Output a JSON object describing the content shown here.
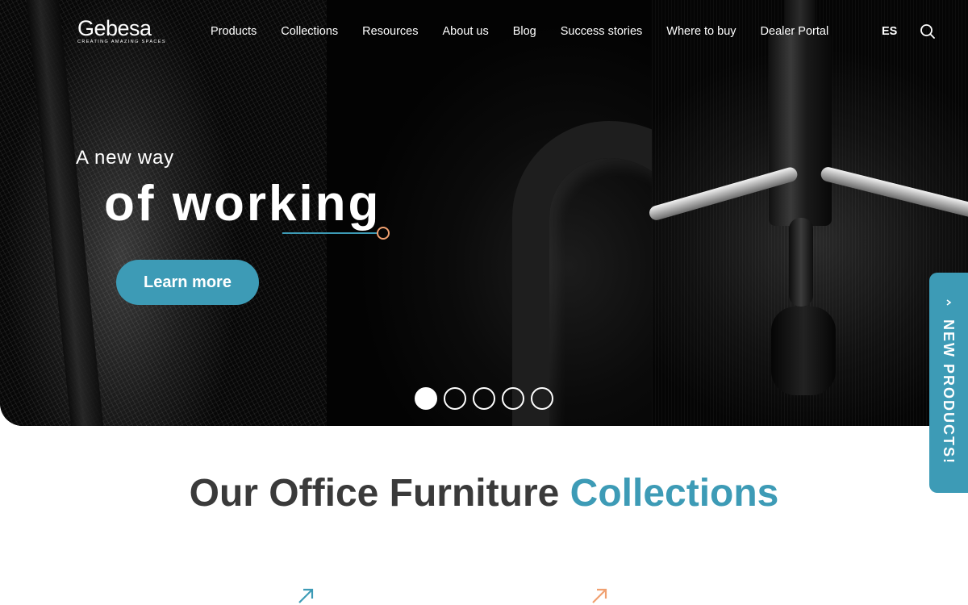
{
  "brand": {
    "name": "Gebesa",
    "tagline": "CREATING AMAZING SPACES"
  },
  "nav": {
    "items": [
      "Products",
      "Collections",
      "Resources",
      "About us",
      "Blog",
      "Success stories",
      "Where to buy",
      "Dealer Portal"
    ],
    "language": "ES",
    "search_icon": "search-icon"
  },
  "hero": {
    "kicker": "A new way",
    "title": "of working",
    "cta_label": "Learn more",
    "slide_count": 5,
    "active_slide": 1
  },
  "side_tab": {
    "label": "NEW PRODUCTS!",
    "icon": "chevron-up-icon"
  },
  "collections": {
    "title_plain": "Our Office Furniture",
    "title_accent": "Collections",
    "arrow_icons": [
      "arrow-up-right-icon",
      "arrow-up-right-icon"
    ]
  },
  "colors": {
    "accent": "#3d9bb6",
    "accent_orange": "#f0a070",
    "hero_bg": "#050505",
    "heading_text": "#3a3a3a"
  }
}
